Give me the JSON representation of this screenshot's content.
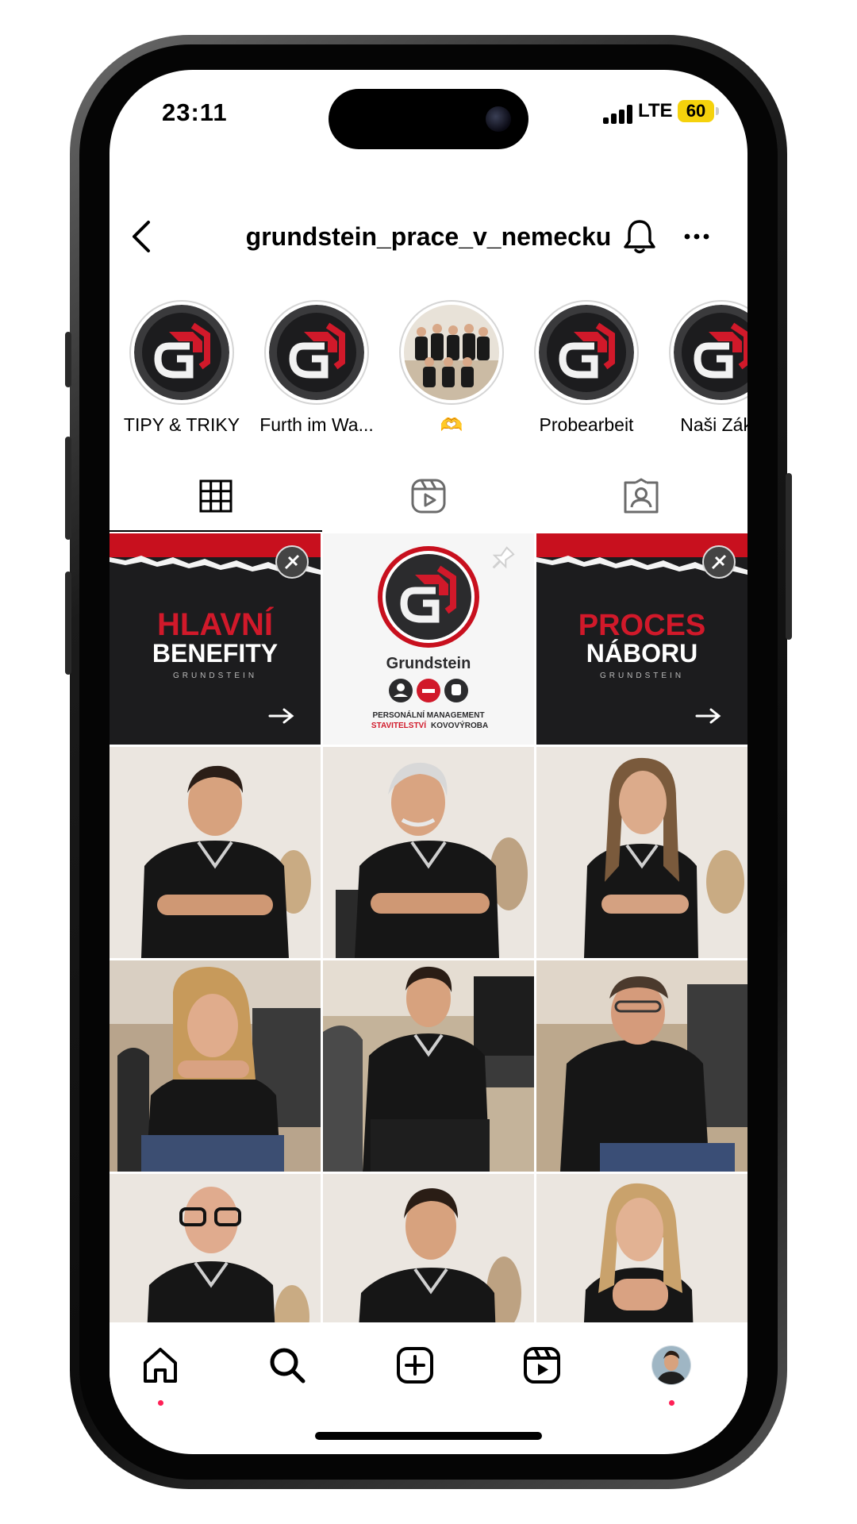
{
  "status_bar": {
    "time": "23:11",
    "network": "LTE",
    "battery": "60"
  },
  "header": {
    "username": "grundstein_prace_v_nemecku",
    "back_icon": "chevron-left-icon",
    "bell_icon": "bell-icon",
    "more_icon": "more-horizontal-icon"
  },
  "highlights": [
    {
      "label": "TIPY & TRIKY",
      "cover": "grundstein-logo"
    },
    {
      "label": "Furth im Wa...",
      "cover": "grundstein-logo"
    },
    {
      "label": "🫶",
      "cover": "team-photo"
    },
    {
      "label": "Probearbeit",
      "cover": "grundstein-logo"
    },
    {
      "label": "Naši Záka",
      "cover": "grundstein-logo"
    }
  ],
  "tabs": [
    {
      "name": "posts",
      "icon": "grid-icon",
      "active": true
    },
    {
      "name": "reels",
      "icon": "reels-icon",
      "active": false
    },
    {
      "name": "tagged",
      "icon": "tagged-user-icon",
      "active": false
    }
  ],
  "posts": {
    "post1": {
      "line1": "HLAVNÍ",
      "line2": "BENEFITY",
      "brand": "GRUNDSTEIN",
      "badge_icon": "pinned-icon"
    },
    "post2": {
      "brand": "Grundstein",
      "line1": "PERSONÁLNÍ MANAGEMENT",
      "line2a": "STAVITELSTVÍ",
      "line2b": "KOVOVÝROBA",
      "badge_icon": "pin-icon"
    },
    "post3": {
      "line1": "PROCES",
      "line2": "NÁBORU",
      "brand": "GRUNDSTEIN",
      "badge_icon": "pinned-icon"
    }
  },
  "bottom_nav": [
    {
      "name": "home",
      "icon": "home-icon"
    },
    {
      "name": "search",
      "icon": "search-icon"
    },
    {
      "name": "create",
      "icon": "plus-square-icon"
    },
    {
      "name": "reels",
      "icon": "reels-icon"
    },
    {
      "name": "profile",
      "icon": "profile-avatar-icon"
    }
  ],
  "colors": {
    "brand_red": "#d1192a",
    "dark_bg": "#1c1c1e",
    "notification_dot": "#ff2056",
    "battery": "#f5d20c"
  }
}
